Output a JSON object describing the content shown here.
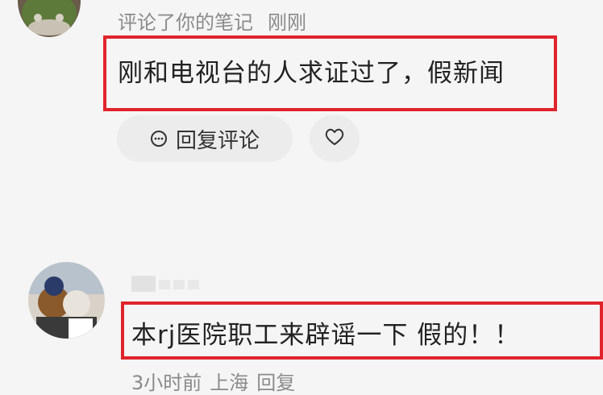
{
  "comment1": {
    "action": "评论了你的笔记",
    "time": "刚刚",
    "text": "刚和电视台的人求证过了，假新闻",
    "reply_label": "回复评论",
    "like_icon": "heart-icon",
    "reply_icon": "comment-bubble-icon"
  },
  "comment2": {
    "text": "本rj医院职工来辟谣一下 假的！！",
    "time": "3小时前",
    "location": "上海",
    "reply_label": "回复"
  },
  "colors": {
    "highlight": "#e0242b",
    "muted_text": "#8a8a8a",
    "background": "#f5f5f5"
  }
}
